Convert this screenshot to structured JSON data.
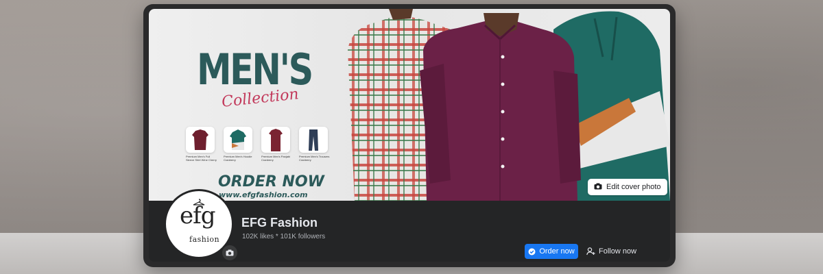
{
  "cover": {
    "headline": "MEN'S",
    "script_text": "Collection",
    "products": [
      {
        "caption": "Premium Men's Full Sleeve Shirt Wine Cherry"
      },
      {
        "caption": "Premium Men's Hoodie Cranberry"
      },
      {
        "caption": "Premium Men's Panjabi Cranberry"
      },
      {
        "caption": "Premium Men's Trousers Cranberry"
      }
    ],
    "cta": "ORDER NOW",
    "url": "www.efgfashion.com",
    "edit_cover_label": "Edit cover photo"
  },
  "profile": {
    "logo_mark": "efg",
    "logo_sub": "fashion",
    "name": "EFG Fashion",
    "stats": "102K likes * 101K followers"
  },
  "actions": {
    "order_label": "Order now",
    "follow_label": "Follow now"
  },
  "icons": {
    "edit_cover": "camera-icon",
    "avatar_edit": "camera-icon",
    "order": "check-circle-icon",
    "follow": "person-add-icon"
  },
  "colors": {
    "accent": "#1877f2",
    "brand_teal": "#2c5a5a",
    "brand_pink": "#c2385a",
    "panel_bg": "#242526"
  }
}
